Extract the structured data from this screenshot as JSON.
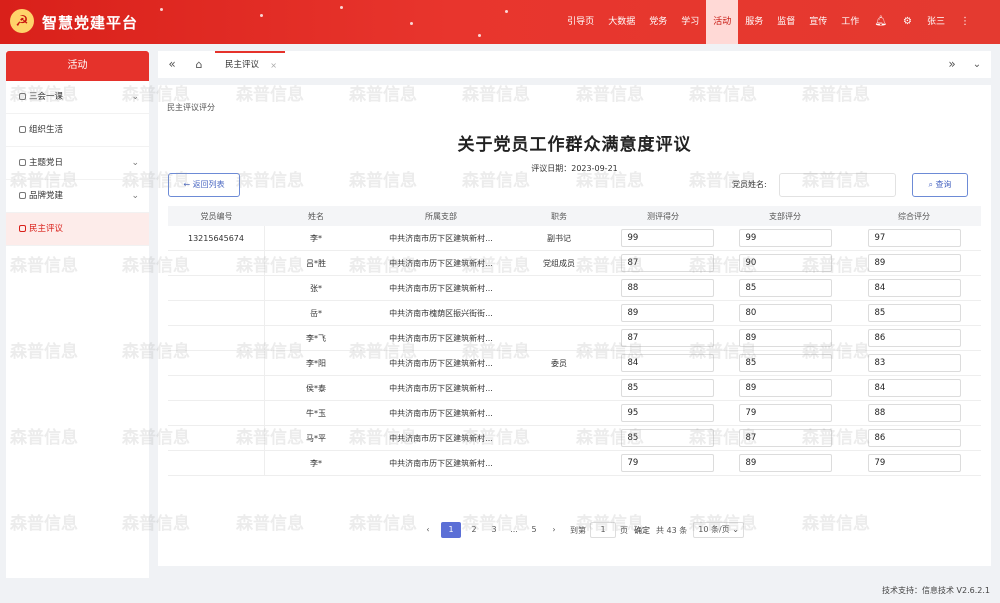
{
  "header": {
    "logo_glyph": "☭",
    "app_title": "智慧党建平台",
    "nav": [
      "引导页",
      "大数据",
      "党务",
      "学习",
      "活动",
      "服务",
      "监督",
      "宣传",
      "工作"
    ],
    "active_nav": "活动",
    "user": "张三",
    "brand_color": "#e5322b"
  },
  "sidebar": {
    "title": "活动",
    "items": [
      {
        "label": "三会一课",
        "has_children": true
      },
      {
        "label": "组织生活",
        "has_children": false
      },
      {
        "label": "主题党日",
        "has_children": true
      },
      {
        "label": "品牌党建",
        "has_children": true
      },
      {
        "label": "民主评议",
        "has_children": false,
        "active": true
      }
    ]
  },
  "tabs": {
    "open_tab": "民主评议"
  },
  "main": {
    "breadcrumb": "民主评议评分",
    "title": "关于党员工作群众满意度评议",
    "eval_date_label": "评议日期：",
    "eval_date": "2023-09-21",
    "back_label": "返回列表",
    "member_name_label": "党员姓名:",
    "query_label": "查询"
  },
  "table": {
    "columns": [
      "党员编号",
      "姓名",
      "所属支部",
      "职务",
      "测评得分",
      "支部评分",
      "综合评分"
    ],
    "rows": [
      [
        "13215645674",
        "李*",
        "中共济南市历下区建筑新村...",
        "副书记",
        "99",
        "99",
        "97"
      ],
      [
        "",
        "吕*胜",
        "中共济南市历下区建筑新村...",
        "党组成员",
        "87",
        "90",
        "89"
      ],
      [
        "",
        "张*",
        "中共济南市历下区建筑新村...",
        "",
        "88",
        "85",
        "84"
      ],
      [
        "",
        "岳*",
        "中共济南市槐荫区振兴街街...",
        "",
        "89",
        "80",
        "85"
      ],
      [
        "",
        "李*飞",
        "中共济南市历下区建筑新村...",
        "",
        "87",
        "89",
        "86"
      ],
      [
        "",
        "李*阳",
        "中共济南市历下区建筑新村...",
        "委员",
        "84",
        "85",
        "83"
      ],
      [
        "",
        "侯*泰",
        "中共济南市历下区建筑新村...",
        "",
        "85",
        "89",
        "84"
      ],
      [
        "",
        "牛*玉",
        "中共济南市历下区建筑新村...",
        "",
        "95",
        "79",
        "88"
      ],
      [
        "",
        "马*平",
        "中共济南市历下区建筑新村...",
        "",
        "85",
        "87",
        "86"
      ],
      [
        "",
        "李*",
        "中共济南市历下区建筑新村...",
        "",
        "79",
        "89",
        "79"
      ]
    ]
  },
  "pager": {
    "pages": [
      "1",
      "2",
      "3",
      "...",
      "5"
    ],
    "current": "1",
    "goto_label": "到第",
    "goto_value": "1",
    "page_unit": "页",
    "confirm": "确定",
    "total": "共 43 条",
    "page_size": "10 条/页"
  },
  "footer": {
    "text": "技术支持：信息技术  V2.6.2.1"
  },
  "watermark": "森普信息"
}
